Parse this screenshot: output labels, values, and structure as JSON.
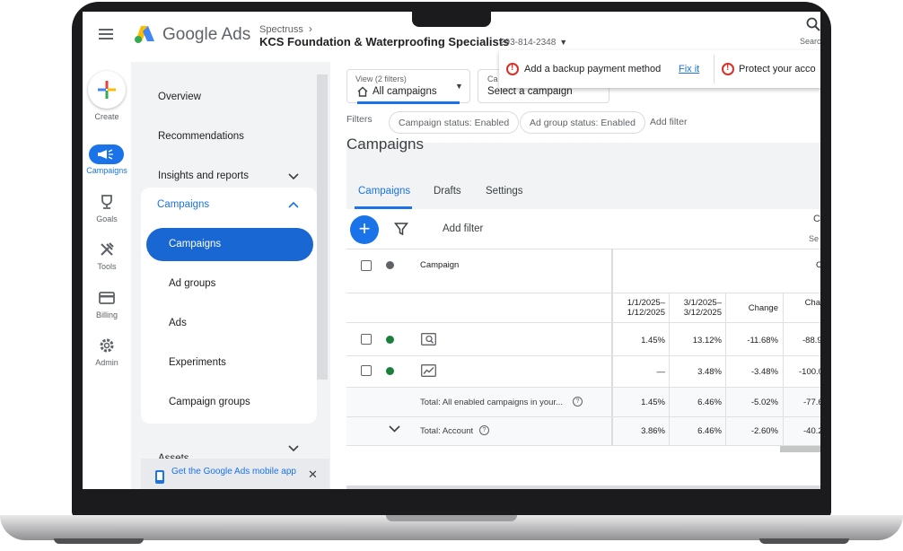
{
  "header": {
    "brand": "Google Ads",
    "account_parent": "Spectruss",
    "account_name": "KCS Foundation & Waterproofing Specialists",
    "account_id": "293-814-2348",
    "search_label": "Searc"
  },
  "rail": {
    "create": "Create",
    "campaigns": "Campaigns",
    "goals": "Goals",
    "tools": "Tools",
    "billing": "Billing",
    "admin": "Admin"
  },
  "menu": {
    "overview": "Overview",
    "recommendations": "Recommendations",
    "insights": "Insights and reports",
    "campaigns": "Campaigns",
    "sub": [
      "Campaigns",
      "Ad groups",
      "Ads",
      "Experiments",
      "Campaign groups"
    ],
    "assets": "Assets",
    "promo": "Get the Google Ads mobile app"
  },
  "view_selector": {
    "small": "View (2 filters)",
    "main": "All campaigns"
  },
  "campaign_selector": {
    "small": "Ca",
    "main": "Select a campaign"
  },
  "notifications": {
    "first": "Add a backup payment method",
    "first_link": "Fix it",
    "second": "Protect your acco"
  },
  "filters": {
    "label": "Filters",
    "chips": [
      "Campaign status: Enabled",
      "Ad group status: Enabled"
    ],
    "add": "Add filter"
  },
  "page_title": "Campaigns",
  "tabs": [
    "Campaigns",
    "Drafts",
    "Settings"
  ],
  "toolbar": {
    "add_filter": "Add filter",
    "segment_icon": "C",
    "segment_label": "Se"
  },
  "table": {
    "campaign_header": "Campaign",
    "top_right_header": "C",
    "col_headers": [
      "1/1/2025–\n1/12/2025",
      "3/1/2025–\n3/12/2025",
      "Change",
      "Cha"
    ],
    "rows": [
      {
        "type_icon": "search-campaign-icon",
        "status_color": "#188038",
        "values": [
          "1.45%",
          "13.12%",
          "-11.68%",
          "-88.9"
        ]
      },
      {
        "type_icon": "display-campaign-icon",
        "status_color": "#188038",
        "values": [
          "—",
          "3.48%",
          "-3.48%",
          "-100.0"
        ]
      }
    ],
    "totals": [
      {
        "label": "Total: All enabled campaigns in your...",
        "values": [
          "1.45%",
          "6.46%",
          "-5.02%",
          "-77.6"
        ]
      },
      {
        "label": "Total: Account",
        "values": [
          "3.86%",
          "6.46%",
          "-2.60%",
          "-40.2"
        ]
      }
    ]
  },
  "colors": {
    "accent": "#1a73e8",
    "status_enabled": "#188038",
    "status_header": "#5f6368",
    "error": "#d93025"
  }
}
